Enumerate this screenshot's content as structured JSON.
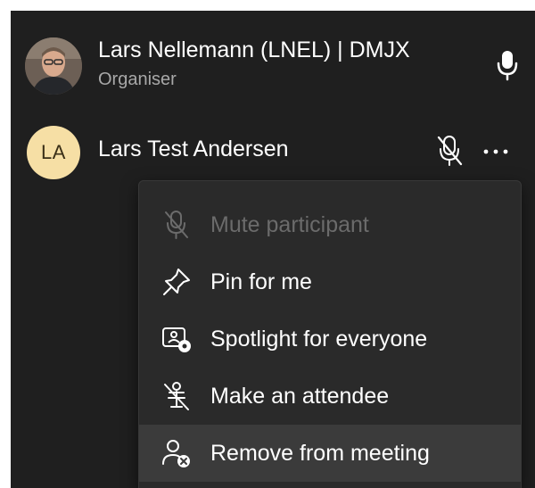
{
  "participants": [
    {
      "name": "Lars Nellemann (LNEL) | DMJX",
      "role": "Organiser",
      "mic_icon": "microphone-icon"
    },
    {
      "initials": "LA",
      "name": "Lars Test Andersen",
      "mic_icon": "microphone-off-icon",
      "more_icon": "more-options-icon",
      "avatar_color": "#f6dfa5"
    }
  ],
  "context_menu": {
    "items": [
      {
        "label": "Mute participant",
        "icon": "microphone-off-icon",
        "disabled": true
      },
      {
        "label": "Pin for me",
        "icon": "pin-icon",
        "disabled": false
      },
      {
        "label": "Spotlight for everyone",
        "icon": "spotlight-icon",
        "disabled": false
      },
      {
        "label": "Make an attendee",
        "icon": "make-attendee-icon",
        "disabled": false
      },
      {
        "label": "Remove from meeting",
        "icon": "remove-person-icon",
        "disabled": false,
        "hovered": true
      }
    ]
  },
  "colors": {
    "panel_bg": "#1f1f1f",
    "menu_bg": "#2a2a2a",
    "menu_hover_bg": "#3b3b3b",
    "text_primary": "#ffffff",
    "text_secondary": "#a8a8a8",
    "text_disabled": "#6b6b6b"
  }
}
